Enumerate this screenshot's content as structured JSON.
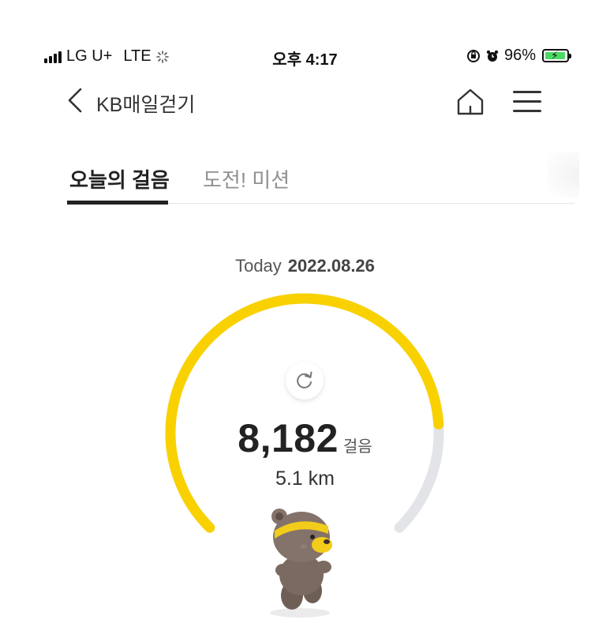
{
  "status_bar": {
    "carrier": "LG U+",
    "network": "LTE",
    "time": "오후 4:17",
    "battery": "96%",
    "icons": [
      "signal-icon",
      "activity-spinner-icon",
      "orientation-lock-icon",
      "alarm-icon",
      "battery-charging-icon"
    ]
  },
  "header": {
    "title": "KB매일걷기",
    "icons": [
      "back-icon",
      "home-icon",
      "menu-icon"
    ]
  },
  "tabs": [
    {
      "label": "오늘의 걸음",
      "active": true
    },
    {
      "label": "도전! 미션",
      "active": false
    }
  ],
  "date": {
    "label": "Today",
    "value": "2022.08.26"
  },
  "steps": {
    "count": "8,182",
    "unit": "걸음",
    "distance": "5.1 km",
    "progress_fraction": 0.82
  },
  "colors": {
    "accent": "#f9d100",
    "track": "#e2e4e7",
    "text": "#222222",
    "tab_inactive": "#8f8f8f",
    "battery_fill": "#4cd964"
  }
}
